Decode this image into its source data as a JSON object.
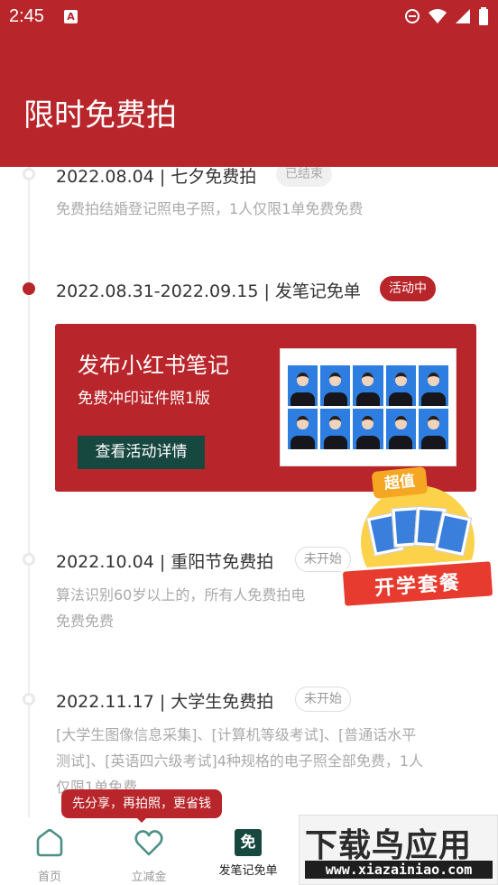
{
  "status_bar": {
    "time": "2:45",
    "notif_letter": "A"
  },
  "header": {
    "title": "限时免费拍"
  },
  "events": [
    {
      "title": "2022.08.04 | 七夕免费拍",
      "status": "已结束",
      "desc": "免费拍结婚登记照电子照，1人仅限1单免费免费"
    },
    {
      "title": "2022.08.31-2022.09.15 | 发笔记免单",
      "status": "活动中"
    },
    {
      "title": "2022.10.04 | 重阳节免费拍",
      "status": "未开始",
      "desc_lines": [
        "算法识别60岁以上的，所有人免费拍电",
        "免费免费"
      ]
    },
    {
      "title": "2022.11.17 | 大学生免费拍",
      "status": "未开始",
      "desc_lines": [
        "[大学生图像信息采集]、[计算机等级考试]、[普通话水平",
        "测试]、[英语四六级考试]4种规格的电子照全部免费，1人",
        "仅限1单免费"
      ]
    }
  ],
  "promo": {
    "heading": "发布小红书笔记",
    "subheading": "免费冲印证件照1版",
    "button": "查看活动详情"
  },
  "float_badge": {
    "top": "超值",
    "ribbon": "开学套餐"
  },
  "tooltip": {
    "text": "先分享，再拍照，更省钱"
  },
  "nav": {
    "items": [
      {
        "label": "首页",
        "icon": "home-icon"
      },
      {
        "label": "立减金",
        "icon": "heart-icon"
      },
      {
        "label": "发笔记免单",
        "icon": "free-badge-icon",
        "glyph": "免"
      }
    ]
  },
  "watermark": {
    "big": "下载鸟应用",
    "small": "www.xiazainiao.com"
  },
  "colors": {
    "primary": "#b8252a",
    "dark_green": "#17483f",
    "muted": "#aaaaaa"
  }
}
